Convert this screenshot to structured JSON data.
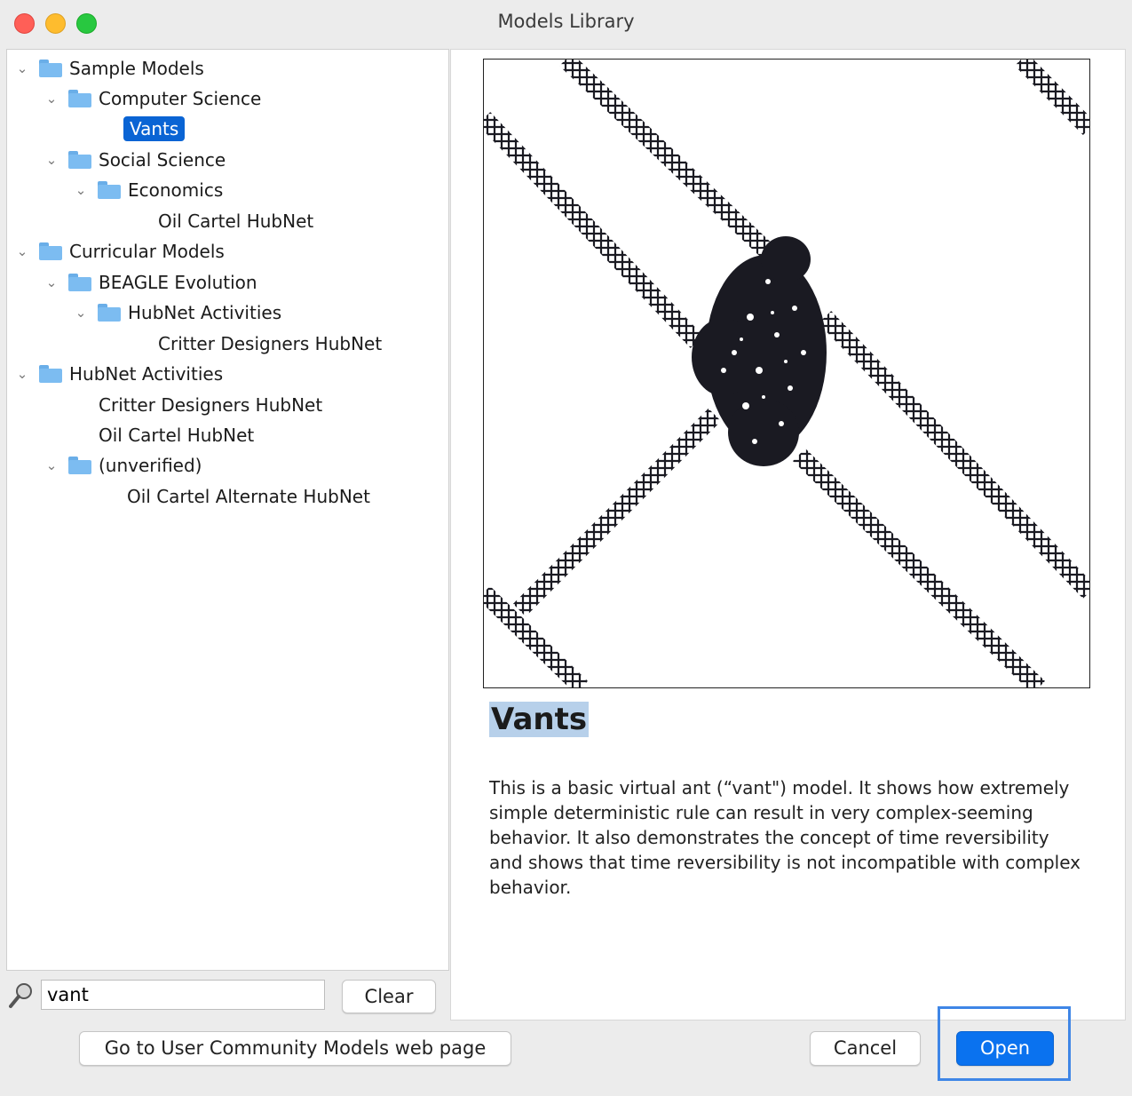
{
  "window": {
    "title": "Models Library"
  },
  "tree": {
    "sample_models": "Sample Models",
    "computer_science": "Computer Science",
    "vants": "Vants",
    "social_science": "Social Science",
    "economics": "Economics",
    "oil_cartel_hubnet_1": "Oil Cartel HubNet",
    "curricular_models": "Curricular Models",
    "beagle_evolution": "BEAGLE Evolution",
    "hubnet_activities_1": "HubNet Activities",
    "critter_designers_1": "Critter Designers HubNet",
    "hubnet_activities_2": "HubNet Activities",
    "critter_designers_2": "Critter Designers HubNet",
    "oil_cartel_hubnet_2": "Oil Cartel HubNet",
    "unverified": "(unverified)",
    "oil_cartel_alternate": "Oil Cartel Alternate HubNet"
  },
  "search": {
    "value": "vant",
    "clear_label": "Clear"
  },
  "preview": {
    "title": "Vants",
    "description": "This is a basic virtual ant (“vant\") model. It shows how extremely simple deterministic rule can result in very complex-seeming behavior. It also demonstrates the concept of time reversibility and shows that time reversibility is not incompatible with complex behavior."
  },
  "buttons": {
    "community": "Go to User Community Models web page",
    "cancel": "Cancel",
    "open": "Open"
  },
  "colors": {
    "selection": "#0a64d4",
    "primary_button": "#0a72ef",
    "folder": "#7cbcf1"
  }
}
